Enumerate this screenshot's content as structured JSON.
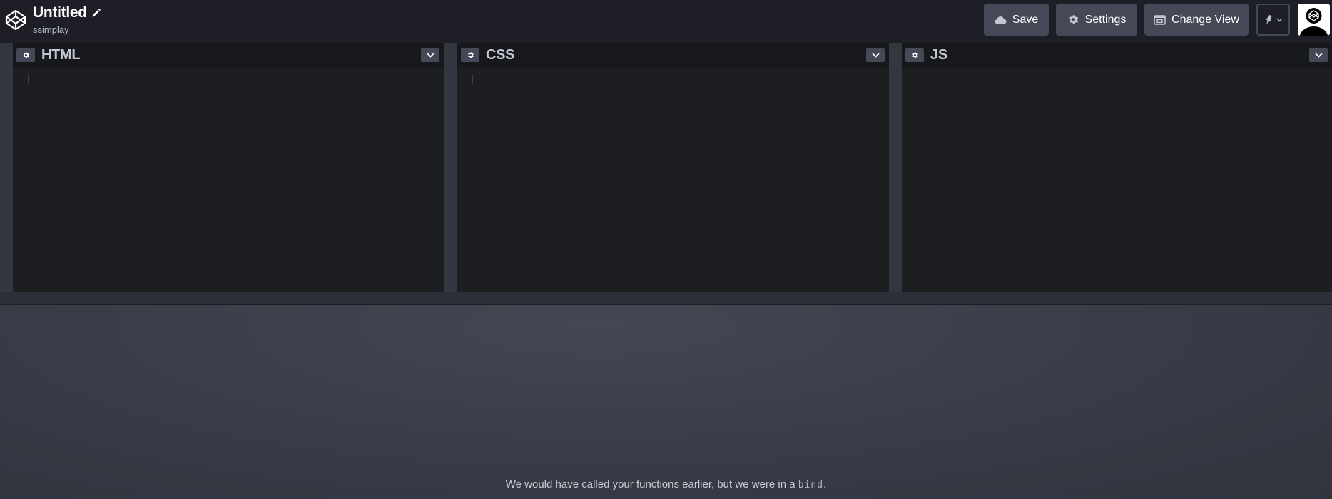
{
  "header": {
    "pen_title": "Untitled",
    "username": "ssimplay",
    "buttons": {
      "save": "Save",
      "settings": "Settings",
      "change_view": "Change View"
    }
  },
  "editors": [
    {
      "name": "HTML"
    },
    {
      "name": "CSS"
    },
    {
      "name": "JS"
    }
  ],
  "preview": {
    "message_before": "We would have called your functions earlier, but we were in a ",
    "message_code": "bind",
    "message_after": "."
  },
  "colors": {
    "header_bg": "#1e1f26",
    "button_bg": "#444857",
    "editor_bg": "#1d1e22",
    "editor_header_bg": "#17181c",
    "preview_bg": "#3c3e4a"
  },
  "icons": {
    "logo": "codepen-logo-icon",
    "edit": "pencil-icon",
    "save": "cloud-icon",
    "settings": "gear-icon",
    "change_view": "layout-icon",
    "pin": "pin-icon",
    "dropdown": "chevron-down-icon"
  }
}
